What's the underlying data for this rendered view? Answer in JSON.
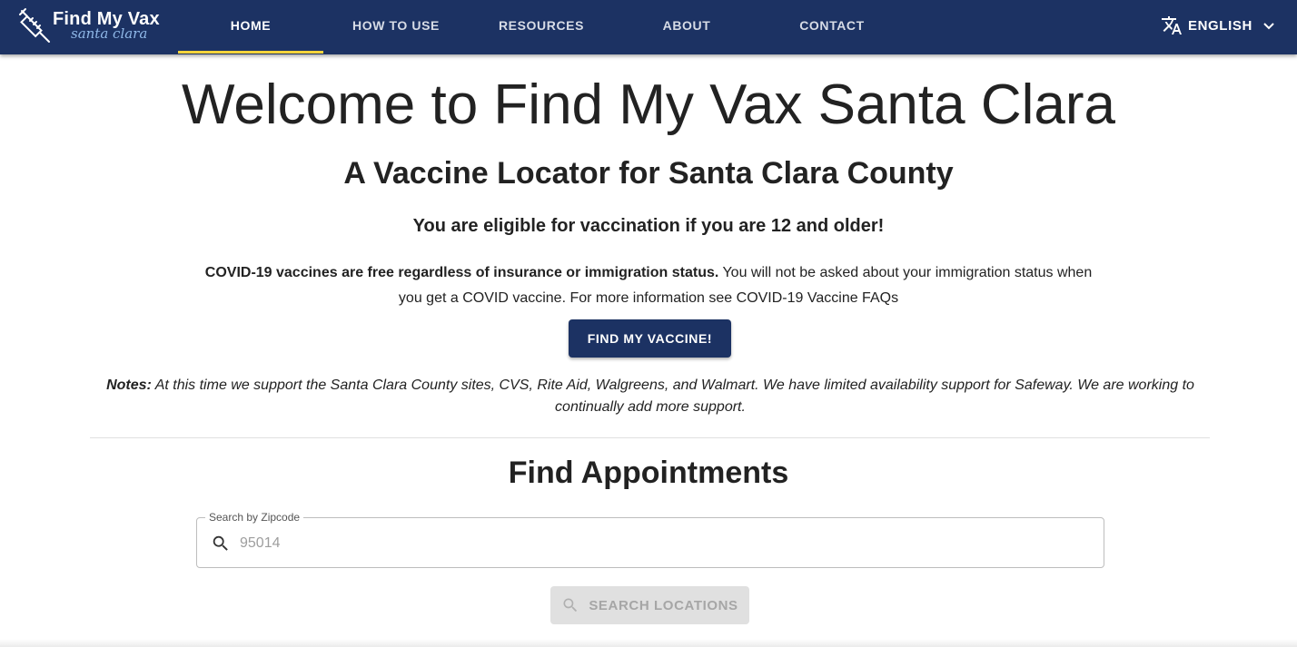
{
  "header": {
    "logo_title": "Find My Vax",
    "logo_subtitle": "santa clara",
    "tabs": [
      {
        "label": "HOME",
        "active": true
      },
      {
        "label": "HOW TO USE",
        "active": false
      },
      {
        "label": "RESOURCES",
        "active": false
      },
      {
        "label": "ABOUT",
        "active": false
      },
      {
        "label": "CONTACT",
        "active": false
      }
    ],
    "language": "ENGLISH"
  },
  "hero": {
    "title": "Welcome to Find My Vax Santa Clara",
    "subtitle": "A Vaccine Locator for Santa Clara County",
    "eligibility": "You are eligible for vaccination if you are 12 and older!",
    "info_bold": "COVID-19 vaccines are free regardless of insurance or immigration status.",
    "info_text": "You will not be asked about your immigration status when you get a COVID vaccine. For more information see COVID-19 Vaccine FAQs",
    "find_button": "FIND MY VACCINE!",
    "notes_label": "Notes:",
    "notes_text": "At this time we support the Santa Clara County sites, CVS, Rite Aid, Walgreens, and Walmart. We have limited availability support for Safeway. We are working to continually add more support."
  },
  "search": {
    "section_title": "Find Appointments",
    "field_label": "Search by Zipcode",
    "placeholder": "95014",
    "button_label": "SEARCH LOCATIONS"
  },
  "colors": {
    "brand_navy": "#1c3263",
    "active_tab_underline": "#f5d43b",
    "disabled_button": "#e0e0e0"
  },
  "icons": [
    "syringe-icon",
    "translate-icon",
    "chevron-down-icon",
    "search-icon"
  ]
}
